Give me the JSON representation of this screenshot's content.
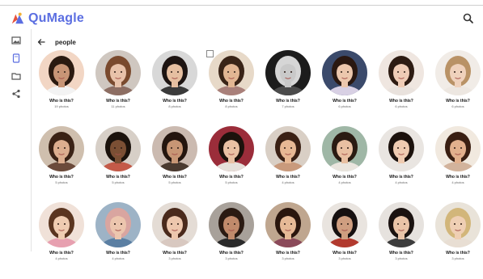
{
  "app": {
    "name": "QuMagle"
  },
  "header": {
    "back_label": "back",
    "title": "people"
  },
  "sidebar": {
    "items": [
      {
        "icon": "image-icon",
        "label": "photos"
      },
      {
        "icon": "tablet-icon",
        "label": "people",
        "active": true
      },
      {
        "icon": "folder-icon",
        "label": "folders"
      },
      {
        "icon": "share-icon",
        "label": "share"
      }
    ]
  },
  "colors": {
    "accent": "#5b6ee1",
    "logo_mark": "#e5533d",
    "active_icon": "#5b6ee1"
  },
  "people": [
    {
      "name": "Who is this?",
      "count": "19 photos",
      "skin": "#c89576",
      "hair": "#2b1a10",
      "bg": "#f2d6c4",
      "shirt": "#f3f3f3"
    },
    {
      "name": "Who is this?",
      "count": "11 photos",
      "skin": "#e8c2aa",
      "hair": "#7a4a2e",
      "bg": "#cfc7c0",
      "shirt": "#8d6e63"
    },
    {
      "name": "Who is this?",
      "count": "8 photos",
      "skin": "#e6bfa1",
      "hair": "#1d1412",
      "bg": "#d8d8d8",
      "shirt": "#3a3a3a"
    },
    {
      "name": "Who is this?",
      "count": "8 photos",
      "skin": "#e2b693",
      "hair": "#3a2417",
      "bg": "#e7d9c8",
      "shirt": "#a9807a"
    },
    {
      "name": "Who is this?",
      "count": "7 photos",
      "skin": "#c9c9c9",
      "hair": "#d6d6d6",
      "bg": "#1c1c1c",
      "shirt": "#4b4b4b"
    },
    {
      "name": "Who is this?",
      "count": "6 photos",
      "skin": "#ecc7ad",
      "hair": "#2a1811",
      "bg": "#3b4a6b",
      "shirt": "#d8d0e4"
    },
    {
      "name": "Who is this?",
      "count": "6 photos",
      "skin": "#efccb6",
      "hair": "#2d1b12",
      "bg": "#efe6e0",
      "shirt": "#e9e2dd"
    },
    {
      "name": "Who is this?",
      "count": "6 photos",
      "skin": "#efd1bc",
      "hair": "#b99266",
      "bg": "#f1ece7",
      "shirt": "#ede7e1"
    },
    {
      "name": "Who is this?",
      "count": "5 photos",
      "skin": "#dcae8f",
      "hair": "#3a2215",
      "bg": "#cfbfae",
      "shirt": "#6b4a3a"
    },
    {
      "name": "Who is this?",
      "count": "5 photos",
      "skin": "#7b4f34",
      "hair": "#1b120c",
      "bg": "#d7cfc7",
      "shirt": "#c45a48"
    },
    {
      "name": "Who is this?",
      "count": "5 photos",
      "skin": "#c79675",
      "hair": "#24150e",
      "bg": "#cbbab0",
      "shirt": "#4a3a30"
    },
    {
      "name": "Who is this?",
      "count": "5 photos",
      "skin": "#e9c1a4",
      "hair": "#1c120c",
      "bg": "#9b2d3a",
      "shirt": "#e6e0da"
    },
    {
      "name": "Who is this?",
      "count": "4 photos",
      "skin": "#e7b894",
      "hair": "#3a2014",
      "bg": "#d9cfc5",
      "shirt": "#c99a7c"
    },
    {
      "name": "Who is this?",
      "count": "4 photos",
      "skin": "#e8c0a2",
      "hair": "#2a1b12",
      "bg": "#9fb7a6",
      "shirt": "#eae5de"
    },
    {
      "name": "Who is this?",
      "count": "4 photos",
      "skin": "#efcbb1",
      "hair": "#1c120d",
      "bg": "#e9e5e1",
      "shirt": "#e9e5e1"
    },
    {
      "name": "Who is this?",
      "count": "4 photos",
      "skin": "#e2b08d",
      "hair": "#3a1f12",
      "bg": "#f1e9df",
      "shirt": "#d2b39c"
    },
    {
      "name": "Who is this?",
      "count": "4 photos",
      "skin": "#efccb1",
      "hair": "#5a3520",
      "bg": "#f0e1d8",
      "shirt": "#e7a0b0"
    },
    {
      "name": "Who is this?",
      "count": "4 photos",
      "skin": "#ecc6ae",
      "hair": "#d9a5a0",
      "bg": "#9db3c6",
      "shirt": "#5b7fa3"
    },
    {
      "name": "Who is this?",
      "count": "3 photos",
      "skin": "#edc7ad",
      "hair": "#4a2a1c",
      "bg": "#e4dcd5",
      "shirt": "#d8c8c0"
    },
    {
      "name": "Who is this?",
      "count": "3 photos",
      "skin": "#c08a6b",
      "hair": "#2a1a12",
      "bg": "#a8a19a",
      "shirt": "#2b2b2b"
    },
    {
      "name": "Who is this?",
      "count": "3 photos",
      "skin": "#e6b996",
      "hair": "#2a160e",
      "bg": "#bfa68f",
      "shirt": "#8b4a5a"
    },
    {
      "name": "Who is this?",
      "count": "3 photos",
      "skin": "#cf9e80",
      "hair": "#161010",
      "bg": "#e9e4df",
      "shirt": "#b23a2e"
    },
    {
      "name": "Who is this?",
      "count": "3 photos",
      "skin": "#e9c4a8",
      "hair": "#1a1210",
      "bg": "#e6e2de",
      "shirt": "#3d3d3d"
    },
    {
      "name": "Who is this?",
      "count": "3 photos",
      "skin": "#efcfb4",
      "hair": "#d2b67a",
      "bg": "#e9e3d9",
      "shirt": "#e8ded3"
    }
  ]
}
